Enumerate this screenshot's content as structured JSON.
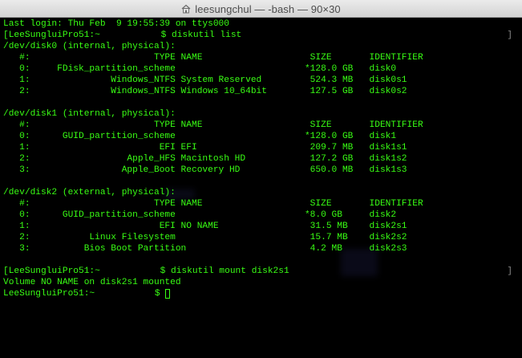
{
  "window": {
    "title": "leesungchul — -bash — 90×30",
    "title_icon": "house-icon",
    "background": "#000000",
    "text_color": "#39ff14"
  },
  "terminal": {
    "lines": [
      "Last login: Thu Feb  9 19:55:39 on ttys000",
      "[LeeSungluiPro51:~ ",
      "/dev/disk0 (internal, physical):",
      "   #:                       TYPE NAME                    SIZE       IDENTIFIER",
      "   0:     FDisk_partition_scheme                        *128.0 GB   disk0",
      "   1:               Windows_NTFS System Reserved         524.3 MB   disk0s1",
      "   2:               Windows_NTFS Windows 10_64bit        127.5 GB   disk0s2",
      "",
      "/dev/disk1 (internal, physical):",
      "   #:                       TYPE NAME                    SIZE       IDENTIFIER",
      "   0:      GUID_partition_scheme                        *128.0 GB   disk1",
      "   1:                        EFI EFI                     209.7 MB   disk1s1",
      "   2:                  Apple_HFS Macintosh HD            127.2 GB   disk1s2",
      "   3:                 Apple_Boot Recovery HD             650.0 MB   disk1s3",
      "",
      "/dev/disk2 (external, physical):",
      "   #:                       TYPE NAME                    SIZE       IDENTIFIER",
      "   0:      GUID_partition_scheme                        *8.0 GB     disk2",
      "   1:                        EFI NO NAME                 31.5 MB    disk2s1",
      "   2:           Linux Filesystem                         15.7 MB    disk2s2",
      "   3:          Bios Boot Partition                       4.2 MB     disk2s3",
      "",
      "[LeeSungluiPro51:~ ",
      "Volume NO NAME on disk2s1 mounted",
      "LeeSungluiPro51:~ "
    ],
    "cmd1_suffix": "$ diskutil list",
    "cmd2_suffix": "$ diskutil mount disk2s1",
    "prompt_suffix": "$ ",
    "right_bracket": "]"
  }
}
